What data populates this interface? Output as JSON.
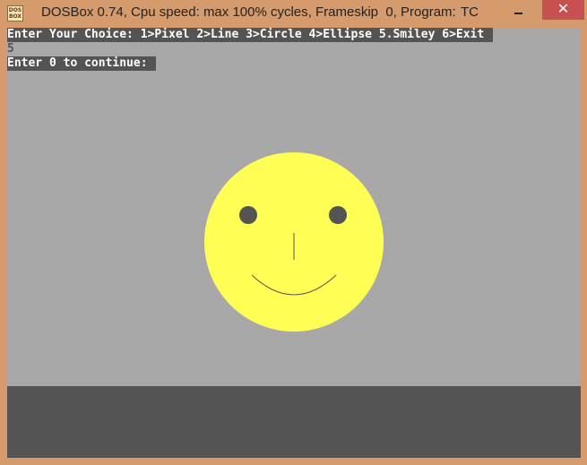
{
  "window": {
    "title": "DOSBox 0.74, Cpu speed: max 100% cycles, Frameskip  0, Program:",
    "program": "TC",
    "icon_label_top": "DOS",
    "icon_label_bottom": "BOX",
    "minimize_icon": "minimize-icon",
    "maximize_icon": "maximize-icon",
    "close_icon": "close-icon",
    "close_glyph": "✕"
  },
  "console": {
    "prompt_line": "Enter Your Choice: 1>Pixel 2>Line 3>Circle 4>Ellipse 5.Smiley 6>Exit ",
    "input_value": "5",
    "continue_line": "Enter 0 to continue: "
  },
  "colors": {
    "title_bar": "#d69b6c",
    "screen_bg": "#a8a8a8",
    "dark_gray": "#545454",
    "face_yellow": "#ffff55",
    "close_button": "#c75050"
  }
}
